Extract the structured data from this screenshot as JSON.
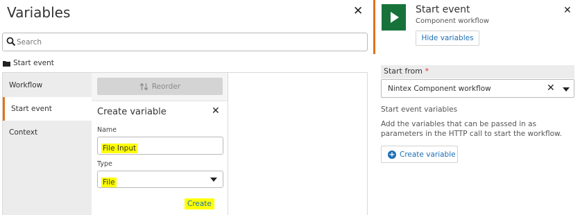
{
  "variables_panel": {
    "title": "Variables",
    "search": {
      "placeholder": "Search",
      "value": ""
    },
    "folder": {
      "label": "Start event"
    },
    "nav_items": [
      {
        "label": "Workflow"
      },
      {
        "label": "Start event",
        "selected": true
      },
      {
        "label": "Context"
      }
    ],
    "reorder_label": "Reorder",
    "create_variable": {
      "title": "Create variable",
      "name_label": "Name",
      "name_value": "File Input",
      "type_label": "Type",
      "type_value": "File",
      "create_label": "Create"
    }
  },
  "event_panel": {
    "title": "Start event",
    "subtitle": "Component workflow",
    "hide_variables_label": "Hide variables",
    "start_from_label": "Start from",
    "required_marker": "*",
    "start_from_value": "Nintex Component workflow",
    "variables_heading": "Start event variables",
    "variables_description": "Add the variables that can be passed in as parameters in the HTTP call to start the workflow.",
    "create_variable_label": "Create variable"
  },
  "colors": {
    "accent_orange": "#e0731c",
    "event_green": "#17723a",
    "link_blue": "#1c6fb5",
    "highlight_yellow": "#ffff00",
    "required_red": "#d9342b"
  },
  "icons": {
    "close": "close-icon",
    "search": "search-icon",
    "folder": "folder-icon",
    "reorder": "reorder-icon",
    "dropdown": "chevron-down-icon",
    "play": "play-icon",
    "plus": "plus-circle-icon",
    "clear": "clear-icon"
  }
}
